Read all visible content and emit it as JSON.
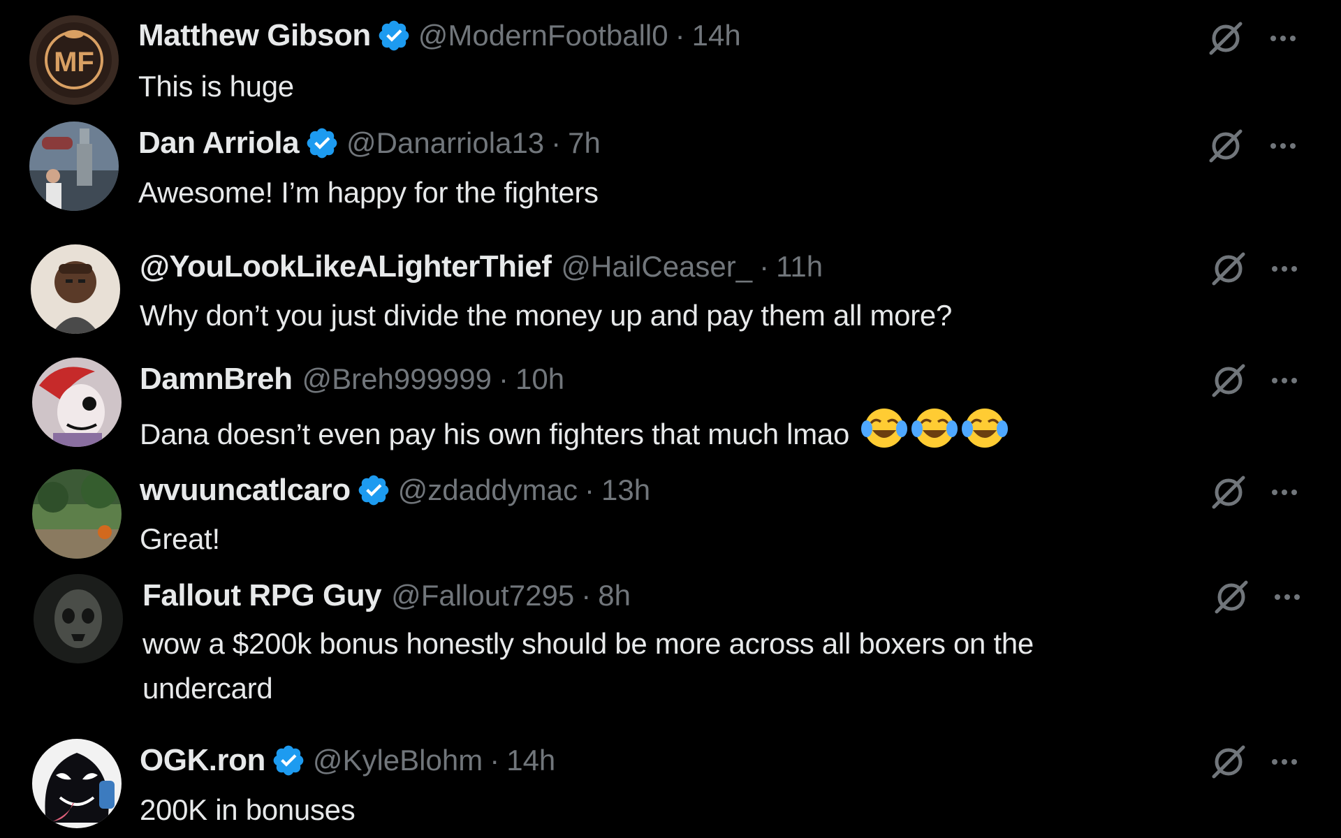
{
  "colors": {
    "background": "#000000",
    "primary_text": "#e7e9ea",
    "secondary_text": "#71767b",
    "verified_blue": "#1d9bf0"
  },
  "replies": [
    {
      "name": "Matthew Gibson",
      "verified": true,
      "handle": "@ModernFootball0",
      "time": "14h",
      "text": "This is huge",
      "avatar_icon": "mf-logo-avatar"
    },
    {
      "name": "Dan Arriola",
      "verified": true,
      "handle": "@Danarriola13",
      "time": "7h",
      "text": "Awesome! I’m happy for the fighters",
      "avatar_icon": "photo-statue-avatar"
    },
    {
      "name": "@YouLookLikeALighterThief",
      "verified": false,
      "handle": "@HailCeaser_",
      "time": "11h",
      "text": "Why don’t you just divide the money up and pay them all more?",
      "avatar_icon": "photo-person-avatar"
    },
    {
      "name": "DamnBreh",
      "verified": false,
      "handle": "@Breh999999",
      "time": "10h",
      "text": "Dana doesn’t even pay his own fighters that much lmao",
      "emojis": [
        "face-with-tears-of-joy",
        "face-with-tears-of-joy",
        "face-with-tears-of-joy"
      ],
      "avatar_icon": "cartoon-avatar"
    },
    {
      "name": "wvuuncatlcaro",
      "verified": true,
      "handle": "@zdaddymac",
      "time": "13h",
      "text": "Great!",
      "avatar_icon": "photo-garden-avatar"
    },
    {
      "name": "Fallout RPG Guy",
      "verified": false,
      "handle": "@Fallout7295",
      "time": "8h",
      "text_line1": "wow a $200k bonus honestly should be more across all boxers on the",
      "text_line2": "undercard",
      "avatar_icon": "skull-mask-avatar"
    },
    {
      "name": "OGK.ron",
      "verified": true,
      "handle": "@KyleBlohm",
      "time": "14h",
      "text": "200K in bonuses",
      "avatar_icon": "venom-avatar"
    }
  ]
}
